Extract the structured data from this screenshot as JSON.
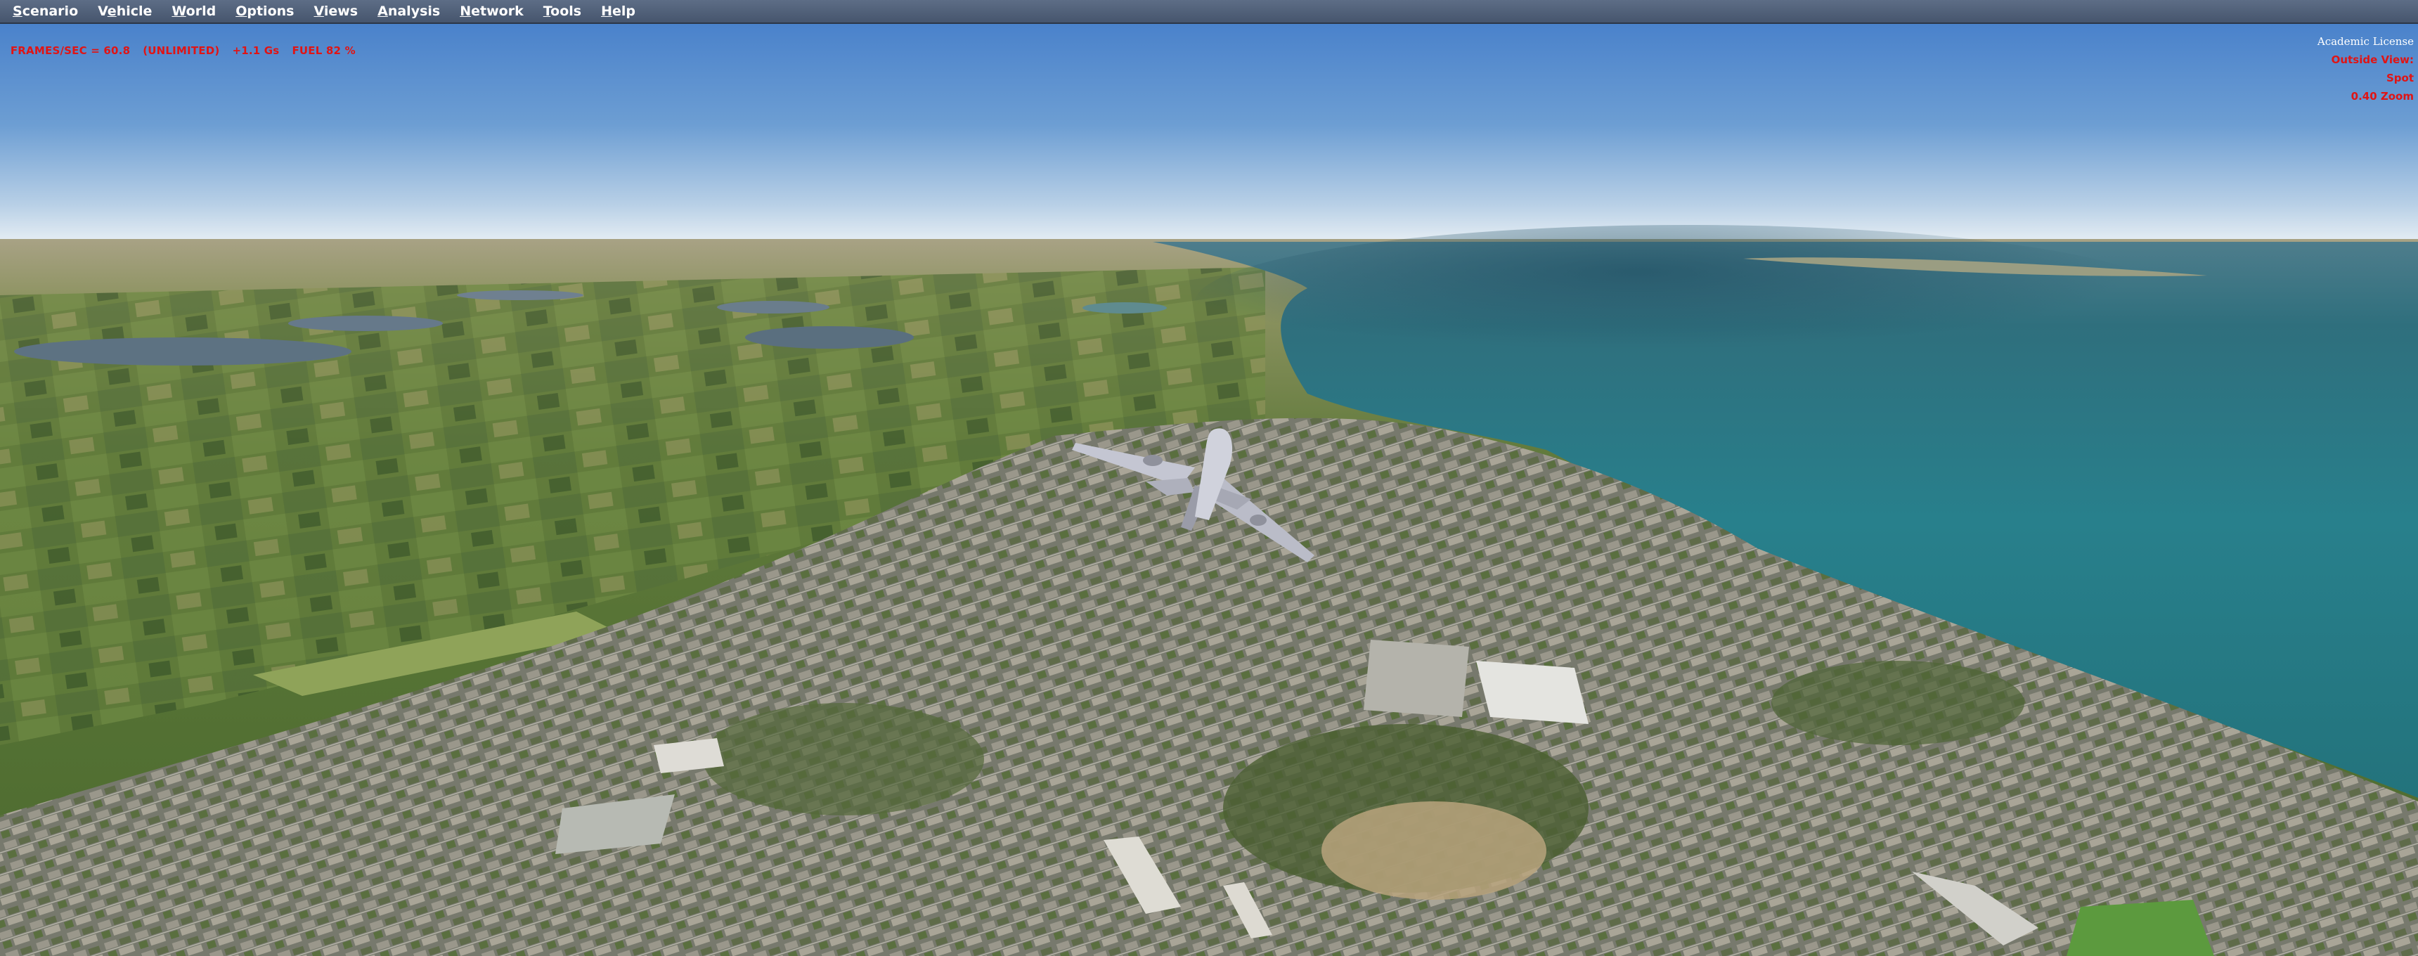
{
  "menu": [
    {
      "mnemonic": "S",
      "rest": "cenario"
    },
    {
      "pre": "V",
      "mnemonic": "e",
      "rest": "hicle"
    },
    {
      "mnemonic": "W",
      "rest": "orld"
    },
    {
      "mnemonic": "O",
      "rest": "ptions"
    },
    {
      "mnemonic": "V",
      "rest": "iews"
    },
    {
      "mnemonic": "A",
      "rest": "nalysis"
    },
    {
      "mnemonic": "N",
      "rest": "etwork"
    },
    {
      "mnemonic": "T",
      "rest": "ools"
    },
    {
      "mnemonic": "H",
      "rest": "elp"
    }
  ],
  "hud": {
    "frames": "FRAMES/SEC = 60.8",
    "unlimited": "(UNLIMITED)",
    "gs": "+1.1 Gs",
    "fuel": "FUEL 82 %"
  },
  "view": {
    "license": "Academic License",
    "view_label": "Outside View:",
    "view_mode": "Spot",
    "zoom": "0.40 Zoom"
  },
  "colors": {
    "hud_text": "#e01414",
    "sky_top": "#4f86cc",
    "sky_horizon": "#e6eef4",
    "sea": "#2a7a86",
    "land": "#5f7a3a",
    "town": "#8c8a80"
  }
}
